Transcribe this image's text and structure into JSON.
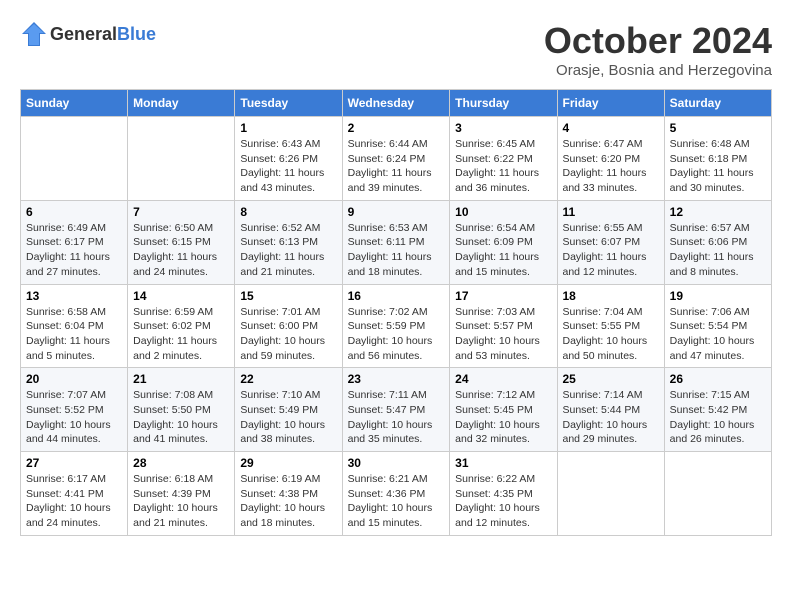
{
  "header": {
    "logo_general": "General",
    "logo_blue": "Blue",
    "month_title": "October 2024",
    "subtitle": "Orasje, Bosnia and Herzegovina"
  },
  "days_of_week": [
    "Sunday",
    "Monday",
    "Tuesday",
    "Wednesday",
    "Thursday",
    "Friday",
    "Saturday"
  ],
  "weeks": [
    [
      {
        "day": null,
        "sunrise": null,
        "sunset": null,
        "daylight": null
      },
      {
        "day": null,
        "sunrise": null,
        "sunset": null,
        "daylight": null
      },
      {
        "day": "1",
        "sunrise": "Sunrise: 6:43 AM",
        "sunset": "Sunset: 6:26 PM",
        "daylight": "Daylight: 11 hours and 43 minutes."
      },
      {
        "day": "2",
        "sunrise": "Sunrise: 6:44 AM",
        "sunset": "Sunset: 6:24 PM",
        "daylight": "Daylight: 11 hours and 39 minutes."
      },
      {
        "day": "3",
        "sunrise": "Sunrise: 6:45 AM",
        "sunset": "Sunset: 6:22 PM",
        "daylight": "Daylight: 11 hours and 36 minutes."
      },
      {
        "day": "4",
        "sunrise": "Sunrise: 6:47 AM",
        "sunset": "Sunset: 6:20 PM",
        "daylight": "Daylight: 11 hours and 33 minutes."
      },
      {
        "day": "5",
        "sunrise": "Sunrise: 6:48 AM",
        "sunset": "Sunset: 6:18 PM",
        "daylight": "Daylight: 11 hours and 30 minutes."
      }
    ],
    [
      {
        "day": "6",
        "sunrise": "Sunrise: 6:49 AM",
        "sunset": "Sunset: 6:17 PM",
        "daylight": "Daylight: 11 hours and 27 minutes."
      },
      {
        "day": "7",
        "sunrise": "Sunrise: 6:50 AM",
        "sunset": "Sunset: 6:15 PM",
        "daylight": "Daylight: 11 hours and 24 minutes."
      },
      {
        "day": "8",
        "sunrise": "Sunrise: 6:52 AM",
        "sunset": "Sunset: 6:13 PM",
        "daylight": "Daylight: 11 hours and 21 minutes."
      },
      {
        "day": "9",
        "sunrise": "Sunrise: 6:53 AM",
        "sunset": "Sunset: 6:11 PM",
        "daylight": "Daylight: 11 hours and 18 minutes."
      },
      {
        "day": "10",
        "sunrise": "Sunrise: 6:54 AM",
        "sunset": "Sunset: 6:09 PM",
        "daylight": "Daylight: 11 hours and 15 minutes."
      },
      {
        "day": "11",
        "sunrise": "Sunrise: 6:55 AM",
        "sunset": "Sunset: 6:07 PM",
        "daylight": "Daylight: 11 hours and 12 minutes."
      },
      {
        "day": "12",
        "sunrise": "Sunrise: 6:57 AM",
        "sunset": "Sunset: 6:06 PM",
        "daylight": "Daylight: 11 hours and 8 minutes."
      }
    ],
    [
      {
        "day": "13",
        "sunrise": "Sunrise: 6:58 AM",
        "sunset": "Sunset: 6:04 PM",
        "daylight": "Daylight: 11 hours and 5 minutes."
      },
      {
        "day": "14",
        "sunrise": "Sunrise: 6:59 AM",
        "sunset": "Sunset: 6:02 PM",
        "daylight": "Daylight: 11 hours and 2 minutes."
      },
      {
        "day": "15",
        "sunrise": "Sunrise: 7:01 AM",
        "sunset": "Sunset: 6:00 PM",
        "daylight": "Daylight: 10 hours and 59 minutes."
      },
      {
        "day": "16",
        "sunrise": "Sunrise: 7:02 AM",
        "sunset": "Sunset: 5:59 PM",
        "daylight": "Daylight: 10 hours and 56 minutes."
      },
      {
        "day": "17",
        "sunrise": "Sunrise: 7:03 AM",
        "sunset": "Sunset: 5:57 PM",
        "daylight": "Daylight: 10 hours and 53 minutes."
      },
      {
        "day": "18",
        "sunrise": "Sunrise: 7:04 AM",
        "sunset": "Sunset: 5:55 PM",
        "daylight": "Daylight: 10 hours and 50 minutes."
      },
      {
        "day": "19",
        "sunrise": "Sunrise: 7:06 AM",
        "sunset": "Sunset: 5:54 PM",
        "daylight": "Daylight: 10 hours and 47 minutes."
      }
    ],
    [
      {
        "day": "20",
        "sunrise": "Sunrise: 7:07 AM",
        "sunset": "Sunset: 5:52 PM",
        "daylight": "Daylight: 10 hours and 44 minutes."
      },
      {
        "day": "21",
        "sunrise": "Sunrise: 7:08 AM",
        "sunset": "Sunset: 5:50 PM",
        "daylight": "Daylight: 10 hours and 41 minutes."
      },
      {
        "day": "22",
        "sunrise": "Sunrise: 7:10 AM",
        "sunset": "Sunset: 5:49 PM",
        "daylight": "Daylight: 10 hours and 38 minutes."
      },
      {
        "day": "23",
        "sunrise": "Sunrise: 7:11 AM",
        "sunset": "Sunset: 5:47 PM",
        "daylight": "Daylight: 10 hours and 35 minutes."
      },
      {
        "day": "24",
        "sunrise": "Sunrise: 7:12 AM",
        "sunset": "Sunset: 5:45 PM",
        "daylight": "Daylight: 10 hours and 32 minutes."
      },
      {
        "day": "25",
        "sunrise": "Sunrise: 7:14 AM",
        "sunset": "Sunset: 5:44 PM",
        "daylight": "Daylight: 10 hours and 29 minutes."
      },
      {
        "day": "26",
        "sunrise": "Sunrise: 7:15 AM",
        "sunset": "Sunset: 5:42 PM",
        "daylight": "Daylight: 10 hours and 26 minutes."
      }
    ],
    [
      {
        "day": "27",
        "sunrise": "Sunrise: 6:17 AM",
        "sunset": "Sunset: 4:41 PM",
        "daylight": "Daylight: 10 hours and 24 minutes."
      },
      {
        "day": "28",
        "sunrise": "Sunrise: 6:18 AM",
        "sunset": "Sunset: 4:39 PM",
        "daylight": "Daylight: 10 hours and 21 minutes."
      },
      {
        "day": "29",
        "sunrise": "Sunrise: 6:19 AM",
        "sunset": "Sunset: 4:38 PM",
        "daylight": "Daylight: 10 hours and 18 minutes."
      },
      {
        "day": "30",
        "sunrise": "Sunrise: 6:21 AM",
        "sunset": "Sunset: 4:36 PM",
        "daylight": "Daylight: 10 hours and 15 minutes."
      },
      {
        "day": "31",
        "sunrise": "Sunrise: 6:22 AM",
        "sunset": "Sunset: 4:35 PM",
        "daylight": "Daylight: 10 hours and 12 minutes."
      },
      {
        "day": null,
        "sunrise": null,
        "sunset": null,
        "daylight": null
      },
      {
        "day": null,
        "sunrise": null,
        "sunset": null,
        "daylight": null
      }
    ]
  ]
}
